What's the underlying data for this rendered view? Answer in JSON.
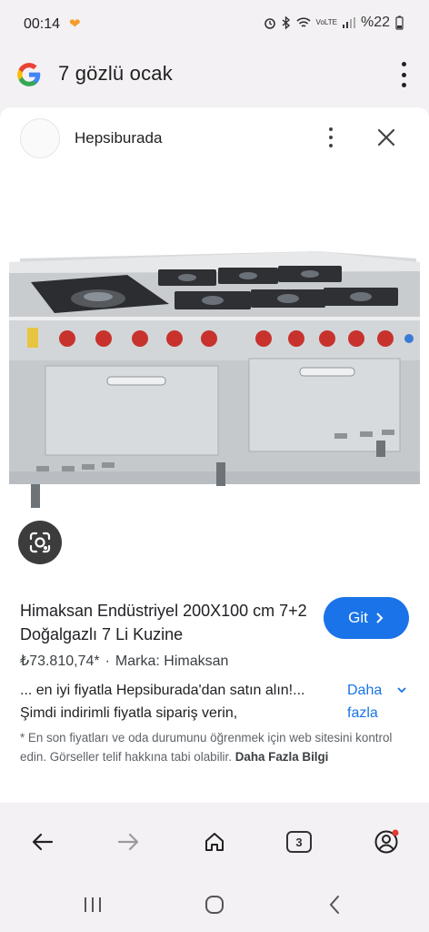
{
  "status": {
    "time": "00:14",
    "battery": "%22",
    "net": "VoLTE"
  },
  "search": {
    "query": "7 gözlü ocak"
  },
  "card": {
    "source": "Hepsiburada",
    "title": "Himaksan Endüstriyel 200X100 cm 7+2 Doğalgazlı 7 Li Kuzine",
    "go_label": "Git",
    "price": "₺73.810,74*",
    "brand": "Marka: Himaksan",
    "description": "... en iyi fiyatla Hepsiburada'dan satın alın!... Şimdi indirimli fiyatla sipariş verin,",
    "more_label": "Daha fazla",
    "disclaimer": "* En son fiyatları ve oda durumunu öğrenmek için web sitesini kontrol edin. Görseller telif hakkına tabi olabilir.",
    "disclaimer_link": "Daha Fazla Bilgi"
  },
  "bottom_nav": {
    "tab_count": "3"
  },
  "icons": {
    "status": [
      "heart-icon",
      "alarm-icon",
      "bluetooth-icon",
      "wifi-icon",
      "signal-icon",
      "battery-icon"
    ],
    "toolbar": [
      "google-logo-icon",
      "more-vert-icon"
    ],
    "card": [
      "favicon-icon",
      "close-icon",
      "lens-icon",
      "chevron-right-icon",
      "chevron-down-icon"
    ],
    "bottom_nav": [
      "back-arrow-icon",
      "forward-arrow-icon",
      "home-icon",
      "tabs-icon",
      "account-icon"
    ],
    "system_nav": [
      "recents-icon",
      "home-circle-icon",
      "back-chevron-icon"
    ]
  },
  "colors": {
    "accent": "#1a73e8",
    "background": "#f3f1f3",
    "card": "#ffffff",
    "notification_dot": "#e53935"
  }
}
